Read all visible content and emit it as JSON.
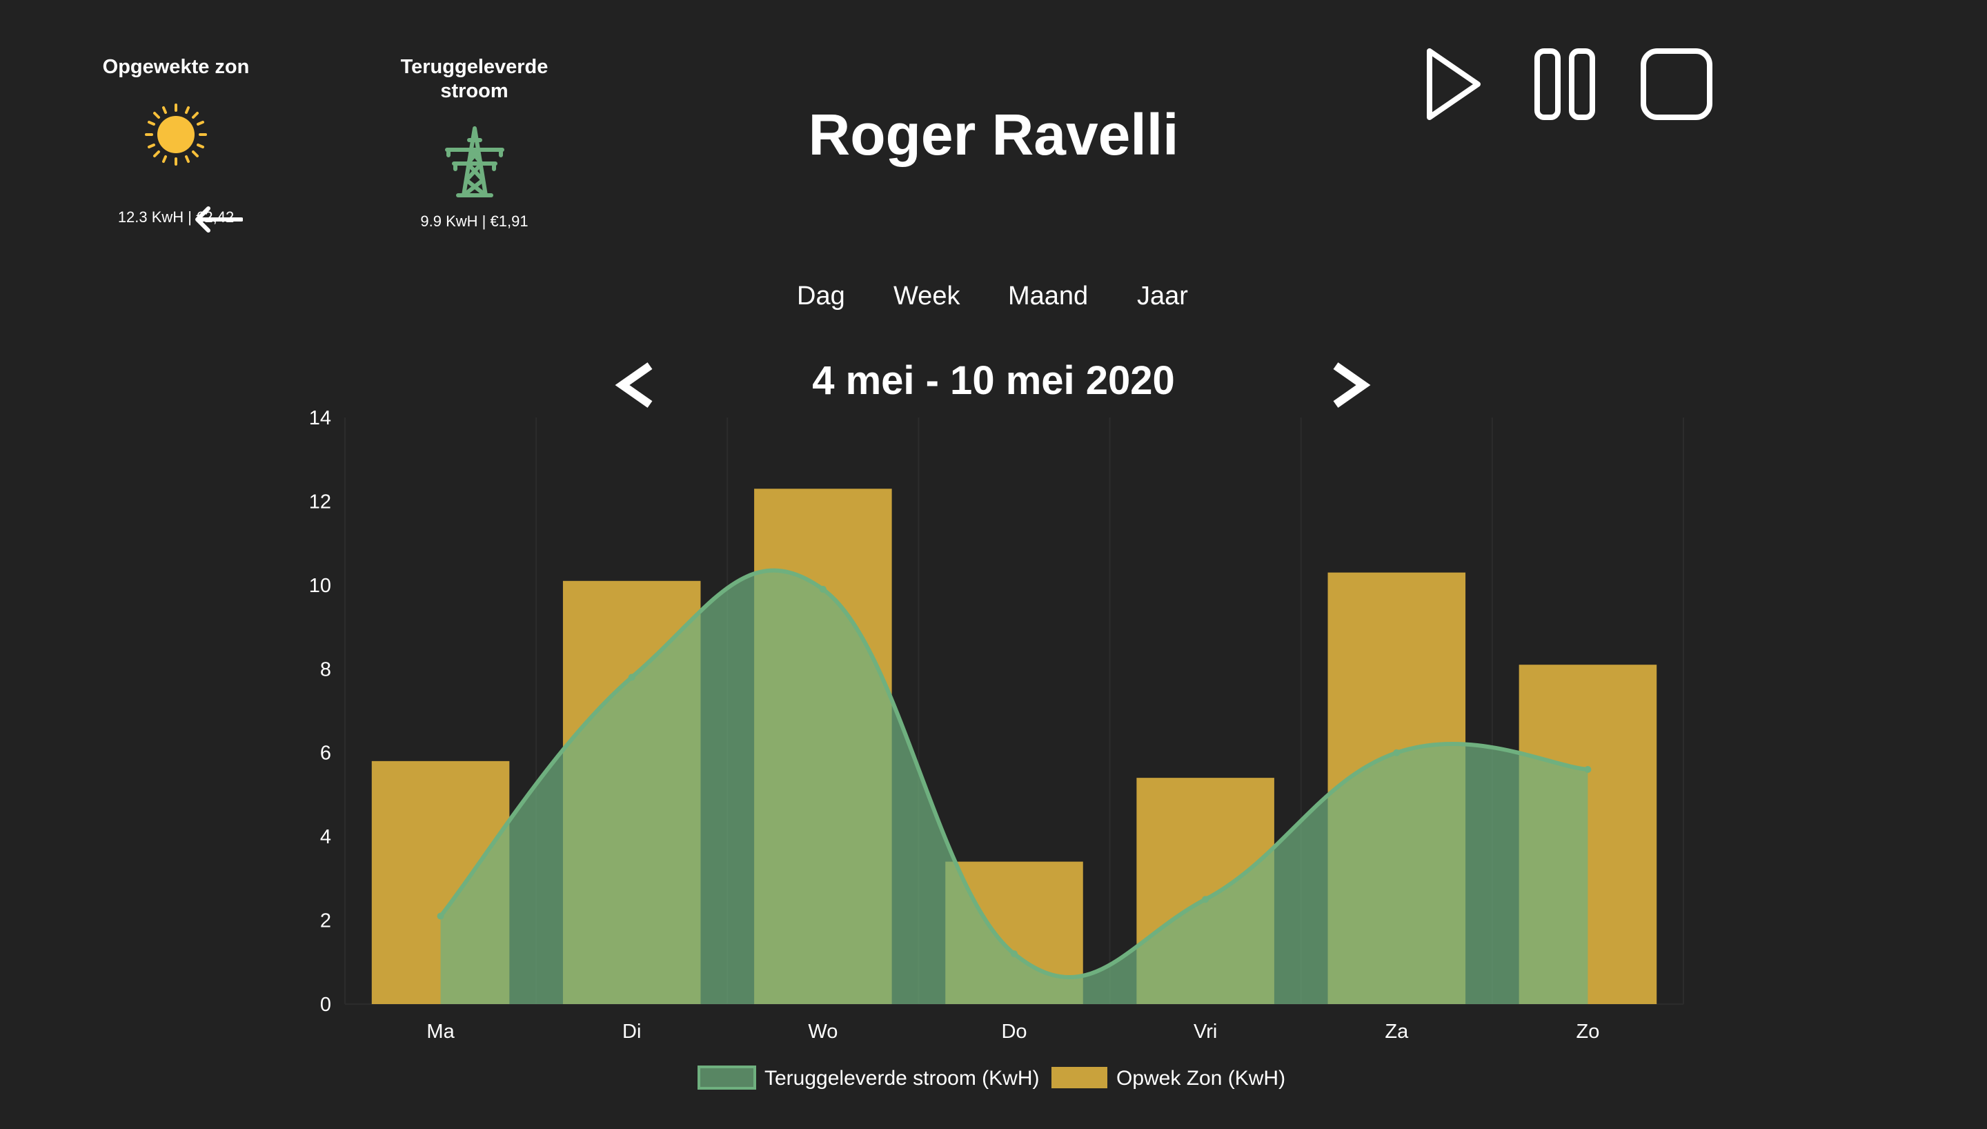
{
  "stats": {
    "sun": {
      "title": "Opgewekte zon",
      "value": "12.3 KwH | €2,42",
      "icon": "sun-icon"
    },
    "grid": {
      "title_line1": "Teruggeleverde",
      "title_line2": "stroom",
      "value": "9.9 KwH | €1,91",
      "icon": "power-pylon-icon"
    }
  },
  "title": "Roger Ravelli",
  "tabs": [
    "Dag",
    "Week",
    "Maand",
    "Jaar"
  ],
  "date_range": "4 mei - 10 mei 2020",
  "media_controls": [
    "play-icon",
    "pause-icon",
    "stop-icon"
  ],
  "colors": {
    "background": "#222222",
    "sun_bar": "#c9a23c",
    "grid_fill": "#6fb07f",
    "grid_line": "#6fb07f",
    "sun_icon": "#f8c03a"
  },
  "chart_data": {
    "type": "bar",
    "categories": [
      "Ma",
      "Di",
      "Wo",
      "Do",
      "Vri",
      "Za",
      "Zo"
    ],
    "series": [
      {
        "name": "Teruggeleverde stroom (KwH)",
        "type": "area",
        "values": [
          2.1,
          7.8,
          9.9,
          1.2,
          2.5,
          6.0,
          5.6
        ],
        "color": "#6fb07f"
      },
      {
        "name": "Opwek Zon (KwH)",
        "type": "bar",
        "values": [
          5.8,
          10.1,
          12.3,
          3.4,
          5.4,
          10.3,
          8.1
        ],
        "color": "#c9a23c"
      }
    ],
    "ylim": [
      0,
      14
    ],
    "yticks": [
      0,
      2,
      4,
      6,
      8,
      10,
      12,
      14
    ],
    "legend": "bottom"
  }
}
